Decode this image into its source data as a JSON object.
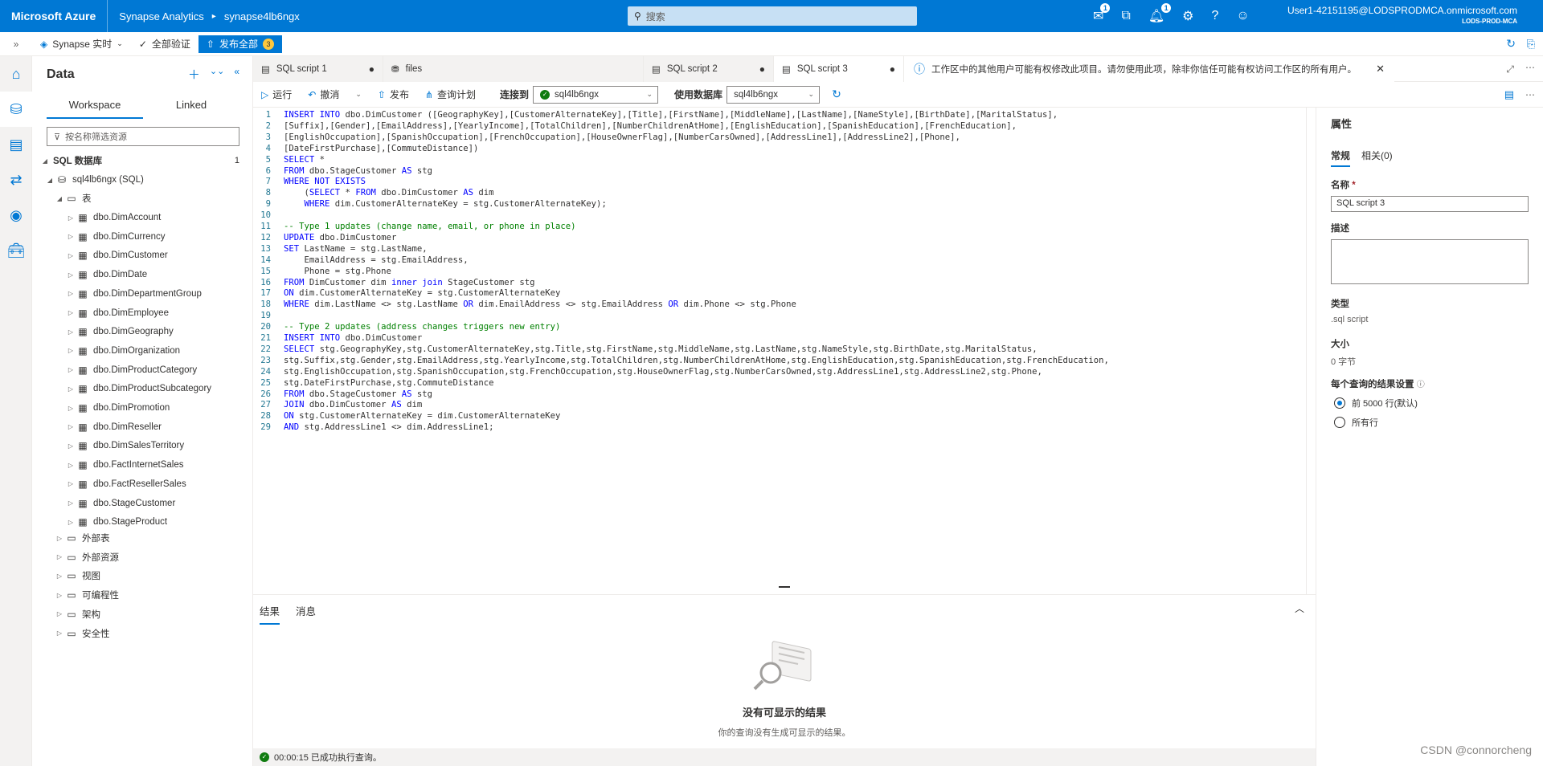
{
  "topbar": {
    "brand": "Microsoft Azure",
    "product": "Synapse Analytics",
    "separator": "▸",
    "workspace": "synapse4lb6ngx",
    "search_placeholder": "搜索",
    "notif_count_1": "1",
    "notif_count_2": "1",
    "user": "User1-42151195@LODSPRODMCA.onmicrosoft.com",
    "tenant": "LODS-PROD-MCA"
  },
  "subbar": {
    "mode": "Synapse 实时",
    "validate": "全部验证",
    "publish_all": "发布全部",
    "publish_count": "3"
  },
  "data_panel": {
    "title": "Data",
    "tabs": [
      "Workspace",
      "Linked"
    ],
    "filter_placeholder": "按名称筛选资源",
    "sql_db_label": "SQL 数据库",
    "sql_db_count": "1",
    "db_name": "sql4lb6ngx (SQL)",
    "tables_folder": "表",
    "tables": [
      "dbo.DimAccount",
      "dbo.DimCurrency",
      "dbo.DimCustomer",
      "dbo.DimDate",
      "dbo.DimDepartmentGroup",
      "dbo.DimEmployee",
      "dbo.DimGeography",
      "dbo.DimOrganization",
      "dbo.DimProductCategory",
      "dbo.DimProductSubcategory",
      "dbo.DimPromotion",
      "dbo.DimReseller",
      "dbo.DimSalesTerritory",
      "dbo.FactInternetSales",
      "dbo.FactResellerSales",
      "dbo.StageCustomer",
      "dbo.StageProduct"
    ],
    "folders": [
      "外部表",
      "外部资源",
      "视图",
      "可编程性",
      "架构",
      "安全性"
    ]
  },
  "doc_tabs": [
    {
      "label": "SQL script 1",
      "dirty": "●"
    },
    {
      "label": "files",
      "dirty": ""
    },
    {
      "label": "SQL script 2",
      "dirty": "●"
    },
    {
      "label": "SQL script 3",
      "dirty": "●"
    }
  ],
  "info_message": "工作区中的其他用户可能有权修改此项目。请勿使用此项，除非你信任可能有权访问工作区的所有用户。",
  "toolbar": {
    "run": "运行",
    "undo": "撤消",
    "publish": "发布",
    "query_plan": "查询计划",
    "connect_to_label": "连接到",
    "connect_to_value": "sql4lb6ngx",
    "use_db_label": "使用数据库",
    "use_db_value": "sql4lb6ngx"
  },
  "code_lines": [
    "INSERT INTO dbo.DimCustomer ([GeographyKey],[CustomerAlternateKey],[Title],[FirstName],[MiddleName],[LastName],[NameStyle],[BirthDate],[MaritalStatus],",
    "[Suffix],[Gender],[EmailAddress],[YearlyIncome],[TotalChildren],[NumberChildrenAtHome],[EnglishEducation],[SpanishEducation],[FrenchEducation],",
    "[EnglishOccupation],[SpanishOccupation],[FrenchOccupation],[HouseOwnerFlag],[NumberCarsOwned],[AddressLine1],[AddressLine2],[Phone],",
    "[DateFirstPurchase],[CommuteDistance])",
    "SELECT *",
    "FROM dbo.StageCustomer AS stg",
    "WHERE NOT EXISTS",
    "    (SELECT * FROM dbo.DimCustomer AS dim",
    "    WHERE dim.CustomerAlternateKey = stg.CustomerAlternateKey);",
    "",
    "-- Type 1 updates (change name, email, or phone in place)",
    "UPDATE dbo.DimCustomer",
    "SET LastName = stg.LastName,",
    "    EmailAddress = stg.EmailAddress,",
    "    Phone = stg.Phone",
    "FROM DimCustomer dim inner join StageCustomer stg",
    "ON dim.CustomerAlternateKey = stg.CustomerAlternateKey",
    "WHERE dim.LastName <> stg.LastName OR dim.EmailAddress <> stg.EmailAddress OR dim.Phone <> stg.Phone",
    "",
    "-- Type 2 updates (address changes triggers new entry)",
    "INSERT INTO dbo.DimCustomer",
    "SELECT stg.GeographyKey,stg.CustomerAlternateKey,stg.Title,stg.FirstName,stg.MiddleName,stg.LastName,stg.NameStyle,stg.BirthDate,stg.MaritalStatus,",
    "stg.Suffix,stg.Gender,stg.EmailAddress,stg.YearlyIncome,stg.TotalChildren,stg.NumberChildrenAtHome,stg.EnglishEducation,stg.SpanishEducation,stg.FrenchEducation,",
    "stg.EnglishOccupation,stg.SpanishOccupation,stg.FrenchOccupation,stg.HouseOwnerFlag,stg.NumberCarsOwned,stg.AddressLine1,stg.AddressLine2,stg.Phone,",
    "stg.DateFirstPurchase,stg.CommuteDistance",
    "FROM dbo.StageCustomer AS stg",
    "JOIN dbo.DimCustomer AS dim",
    "ON stg.CustomerAlternateKey = dim.CustomerAlternateKey",
    "AND stg.AddressLine1 <> dim.AddressLine1;"
  ],
  "results": {
    "tab_results": "结果",
    "tab_messages": "消息",
    "empty_title": "没有可显示的结果",
    "empty_subtitle": "你的查询没有生成可显示的结果。",
    "status": "00:00:15 已成功执行查询。"
  },
  "properties": {
    "title": "属性",
    "tab_general": "常规",
    "tab_related": "相关(0)",
    "name_label": "名称",
    "required_mark": "*",
    "name_value": "SQL script 3",
    "desc_label": "描述",
    "type_label": "类型",
    "type_value": ".sql script",
    "size_label": "大小",
    "size_value": "0 字节",
    "result_setting_label": "每个查询的结果设置",
    "option_5000": "前 5000 行(默认)",
    "option_all": "所有行"
  },
  "watermark": "CSDN @connorcheng",
  "colors": {
    "brand": "#0078d4",
    "keyword": "#0000ff",
    "comment": "#008000",
    "success": "#107c10"
  }
}
